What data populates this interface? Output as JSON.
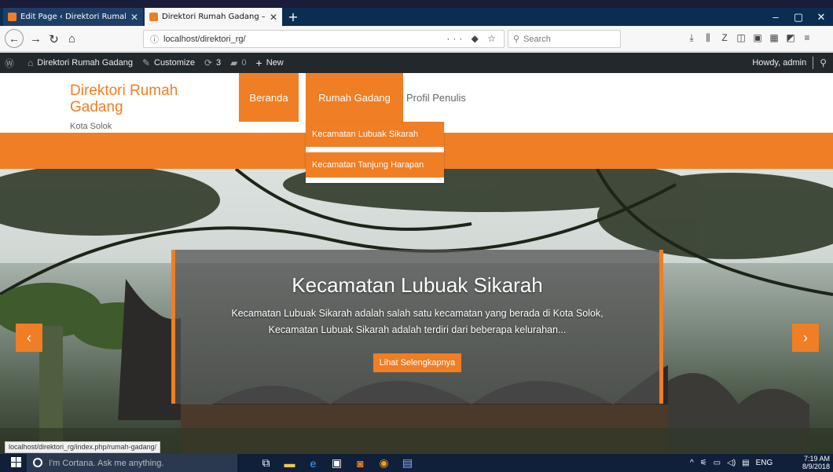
{
  "browser": {
    "tabs": [
      {
        "title": "Edit Page ‹ Direktori Rumah Ga",
        "active": false
      },
      {
        "title": "Direktori Rumah Gadang – Kota",
        "active": true
      }
    ],
    "new_tab_icon": "plus-icon",
    "url": "localhost/direktori_rg/",
    "url_tools": "··· ◆ ☆",
    "search_placeholder": "Search",
    "status_url": "localhost/direktori_rg/index.php/rumah-gadang/"
  },
  "wp_admin_bar": {
    "site_name": "Direktori Rumah Gadang",
    "customize": "Customize",
    "updates": "3",
    "comments": "0",
    "new": "New",
    "howdy": "Howdy, admin"
  },
  "site": {
    "title": "Direktori Rumah Gadang",
    "description": "Kota Solok",
    "menu": {
      "beranda": "Beranda",
      "rumah_gadang": "Rumah Gadang",
      "profil": "Profil Penulis"
    },
    "submenu": [
      "Kecamatan Lubuak Sikarah",
      "Kecamatan Tanjung Harapan"
    ]
  },
  "slider": {
    "heading": "Kecamatan Lubuak Sikarah",
    "text_line1": "Kecamatan Lubuak Sikarah adalah salah satu kecamatan yang berada di Kota Solok,",
    "text_line2": "Kecamatan Lubuak Sikarah adalah terdiri dari beberapa kelurahan...",
    "button": "Lihat Selengkapnya",
    "prev_icon": "‹",
    "next_icon": "›"
  },
  "taskbar": {
    "cortana": "I'm Cortana. Ask me anything.",
    "language": "ENG",
    "time": "7:19 AM",
    "date": "8/9/2018"
  },
  "colors": {
    "accent": "#f07e24",
    "wp_bar": "#23282d",
    "taskbar": "#101f3a"
  }
}
